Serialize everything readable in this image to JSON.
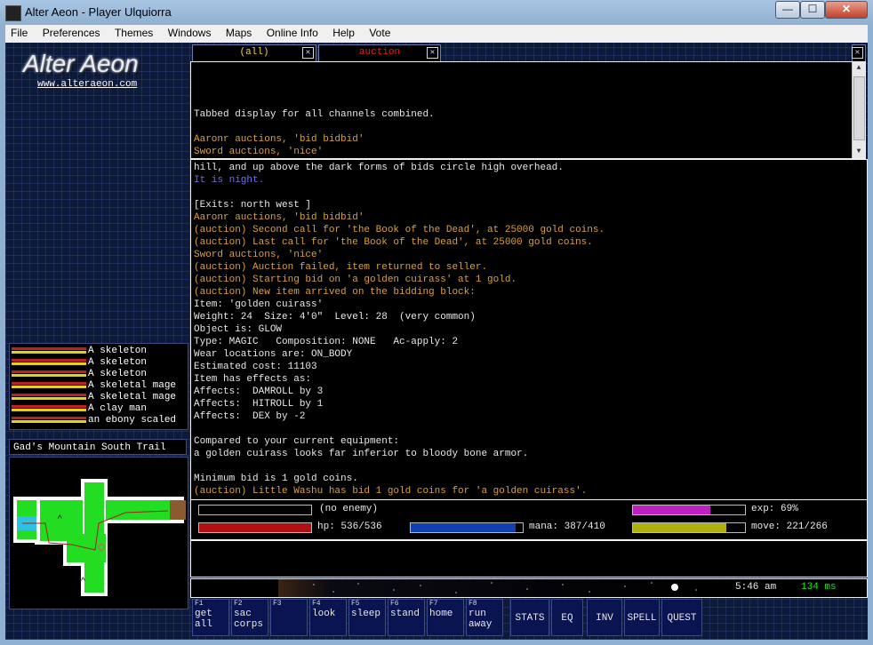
{
  "window": {
    "title": "Alter Aeon - Player Ulquiorra",
    "min": "—",
    "max": "☐",
    "close": "✕"
  },
  "menu": [
    "File",
    "Preferences",
    "Themes",
    "Windows",
    "Maps",
    "Online Info",
    "Help",
    "Vote"
  ],
  "logo": {
    "text": "Alter Aeon",
    "url": "www.alteraeon.com"
  },
  "mobs": [
    {
      "name": "A skeleton"
    },
    {
      "name": "A skeleton"
    },
    {
      "name": "A skeleton"
    },
    {
      "name": "A skeletal mage"
    },
    {
      "name": "A skeletal mage"
    },
    {
      "name": "A clay man"
    },
    {
      "name": "an ebony scaled"
    }
  ],
  "area": "Gad's Mountain South Trail",
  "tabs": [
    {
      "label": "(all)",
      "color": "#f0d040"
    },
    {
      "label": "auction",
      "color": "#e02020"
    }
  ],
  "channel_lines": [
    {
      "text": "Tabbed display for all channels combined.",
      "color": "white"
    },
    {
      "text": "",
      "color": "white"
    },
    {
      "text": "Aaronr auctions, 'bid bidbid'",
      "color": "orange"
    },
    {
      "text": "Sword auctions, 'nice'",
      "color": "orange"
    }
  ],
  "main_lines": [
    {
      "text": "hill, and up above the dark forms of bids circle high overhead.",
      "color": "white"
    },
    {
      "text": "It is night.",
      "color": "blue"
    },
    {
      "text": "",
      "color": "white"
    },
    {
      "text": "[Exits: north west ]",
      "color": "white"
    },
    {
      "text": "Aaronr auctions, 'bid bidbid'",
      "color": "orange"
    },
    {
      "text": "(auction) Second call for 'the Book of the Dead', at 25000 gold coins.",
      "color": "orange"
    },
    {
      "text": "(auction) Last call for 'the Book of the Dead', at 25000 gold coins.",
      "color": "orange"
    },
    {
      "text": "Sword auctions, 'nice'",
      "color": "orange"
    },
    {
      "text": "(auction) Auction failed, item returned to seller.",
      "color": "orange"
    },
    {
      "text": "(auction) Starting bid on 'a golden cuirass' at 1 gold.",
      "color": "orange"
    },
    {
      "text": "(auction) New item arrived on the bidding block:",
      "color": "orange"
    },
    {
      "text": "Item: 'golden cuirass'",
      "color": "white"
    },
    {
      "text": "Weight: 24  Size: 4'0\"  Level: 28  (very common)",
      "color": "white"
    },
    {
      "text": "Object is: GLOW",
      "color": "white"
    },
    {
      "text": "Type: MAGIC   Composition: NONE   Ac-apply: 2",
      "color": "white"
    },
    {
      "text": "Wear locations are: ON_BODY",
      "color": "white"
    },
    {
      "text": "Estimated cost: 11103",
      "color": "white"
    },
    {
      "text": "Item has effects as:",
      "color": "white"
    },
    {
      "text": "Affects:  DAMROLL by 3",
      "color": "white"
    },
    {
      "text": "Affects:  HITROLL by 1",
      "color": "white"
    },
    {
      "text": "Affects:  DEX by -2",
      "color": "white"
    },
    {
      "text": "",
      "color": "white"
    },
    {
      "text": "Compared to your current equipment:",
      "color": "white"
    },
    {
      "text": "a golden cuirass looks far inferior to bloody bone armor.",
      "color": "white"
    },
    {
      "text": "",
      "color": "white"
    },
    {
      "text": "Minimum bid is 1 gold coins.",
      "color": "white"
    },
    {
      "text": "(auction) Little Washu has bid 1 gold coins for 'a golden cuirass'.",
      "color": "orange"
    }
  ],
  "stats": {
    "enemy_label": "(no enemy)",
    "exp_label": "exp: 69%",
    "exp_fraction": 0.69,
    "hp_label": "hp: 536/536",
    "hp_fraction": 1.0,
    "mana_label": "mana: 387/410",
    "mana_fraction": 0.94,
    "move_label": "move: 221/266",
    "move_fraction": 0.83,
    "colors": {
      "exp": "#c020c0",
      "hp": "#b01010",
      "mana": "#1040b0",
      "move": "#b0b010"
    }
  },
  "clock": {
    "time": "5:46 am",
    "ping": "134 ms"
  },
  "fkeys": [
    {
      "key": "F1",
      "label": "get\nall"
    },
    {
      "key": "F2",
      "label": "sac\ncorps"
    },
    {
      "key": "F3",
      "label": ""
    },
    {
      "key": "F4",
      "label": "look"
    },
    {
      "key": "F5",
      "label": "sleep"
    },
    {
      "key": "F6",
      "label": "stand"
    },
    {
      "key": "F7",
      "label": "home"
    },
    {
      "key": "F8",
      "label": "run\naway"
    }
  ],
  "buttons": [
    "STATS",
    "EQ",
    "INV",
    "SPELL",
    "QUEST"
  ]
}
